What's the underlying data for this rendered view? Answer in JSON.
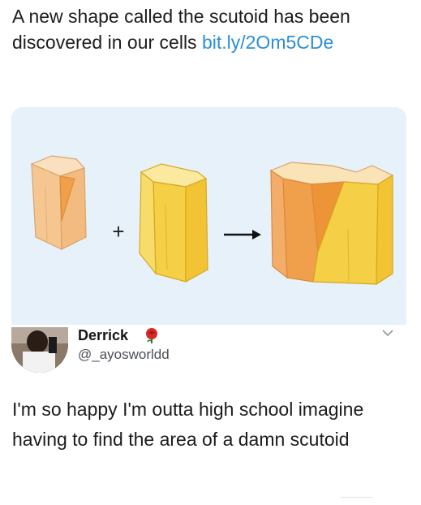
{
  "post": {
    "text": "A new shape called the scutoid has been discovered in our cells",
    "link": "bit.ly/2Om5CDe"
  },
  "diagram": {
    "plus": "+",
    "arrow": "→"
  },
  "reply": {
    "name": "Derrick",
    "handle": "@_ayosworldd",
    "text": "I'm so happy I'm outta high school imagine having to find the area of a damn scutoid"
  },
  "colors": {
    "link": "#2b8fd6",
    "card_bg": "#e6f1fa",
    "peach": "#f6c690",
    "orange": "#f0a04a",
    "yellow": "#f5cf45"
  }
}
